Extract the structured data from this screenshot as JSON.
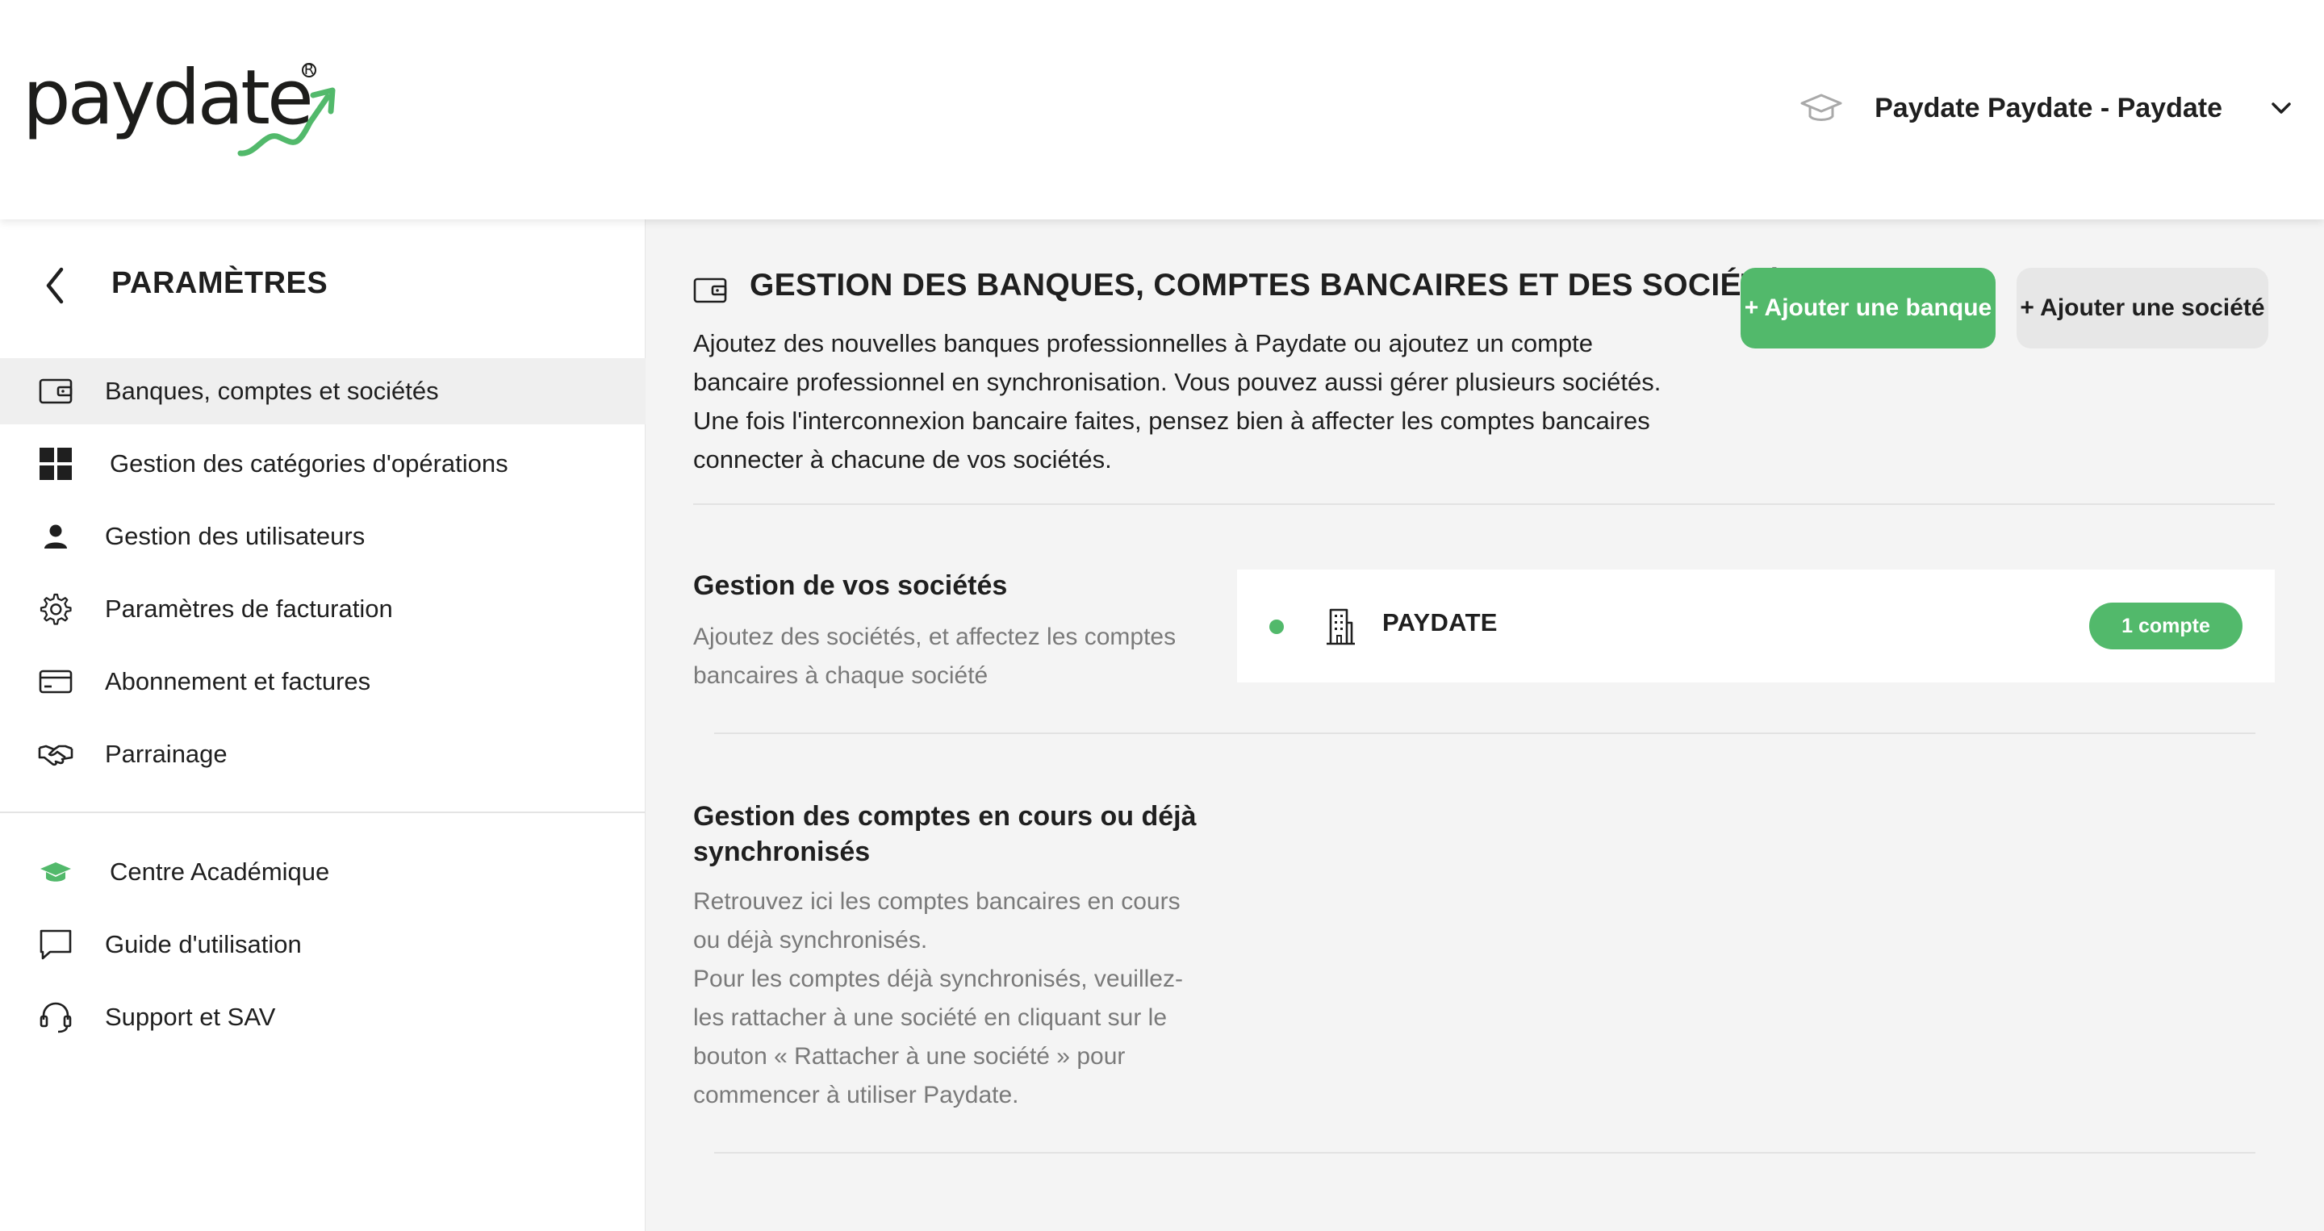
{
  "header": {
    "logo_text": "paydate",
    "user_name": "Paydate Paydate - Paydate"
  },
  "sidebar": {
    "title": "PARAMÈTRES",
    "items": [
      {
        "label": "Banques, comptes et sociétés",
        "icon": "wallet-icon",
        "active": true
      },
      {
        "label": "Gestion des catégories d'opérations",
        "icon": "grid-icon"
      },
      {
        "label": "Gestion des utilisateurs",
        "icon": "user-icon"
      },
      {
        "label": "Paramètres de facturation",
        "icon": "gear-icon"
      },
      {
        "label": "Abonnement et factures",
        "icon": "credit-card-icon"
      },
      {
        "label": "Parrainage",
        "icon": "handshake-icon"
      }
    ],
    "secondary_items": [
      {
        "label": "Centre Académique",
        "icon": "graduation-cap-icon"
      },
      {
        "label": "Guide d'utilisation",
        "icon": "chat-bubble-icon"
      },
      {
        "label": "Support et SAV",
        "icon": "headset-icon"
      }
    ]
  },
  "main": {
    "title": "GESTION DES BANQUES, COMPTES BANCAIRES ET DES SOCIÉTÉS",
    "description": "Ajoutez des nouvelles banques professionnelles à Paydate ou ajoutez un compte bancaire professionnel en synchronisation. Vous pouvez aussi gérer plusieurs sociétés. Une fois l'interconnexion bancaire faites, pensez bien à affecter les comptes bancaires connecter à chacune de vos sociétés.",
    "add_bank_label": "+ Ajouter une banque",
    "add_company_label": "+ Ajouter une société",
    "companies_section": {
      "title": "Gestion de vos sociétés",
      "description": "Ajoutez des sociétés, et affectez les comptes bancaires à chaque société",
      "companies": [
        {
          "name": "PAYDATE",
          "accounts_badge": "1 compte"
        }
      ]
    },
    "accounts_section": {
      "title": "Gestion des comptes en cours ou déjà synchronisés",
      "description_1": "Retrouvez ici les comptes bancaires en cours ou déjà synchronisés.",
      "description_2": "Pour les comptes déjà synchronisés, veuillez-les rattacher à une société en cliquant sur le bouton « Rattacher à une société » pour commencer à utiliser Paydate."
    }
  },
  "colors": {
    "accent_green": "#52b96b",
    "main_bg": "#f4f4f4",
    "active_item_bg": "#efefef"
  }
}
